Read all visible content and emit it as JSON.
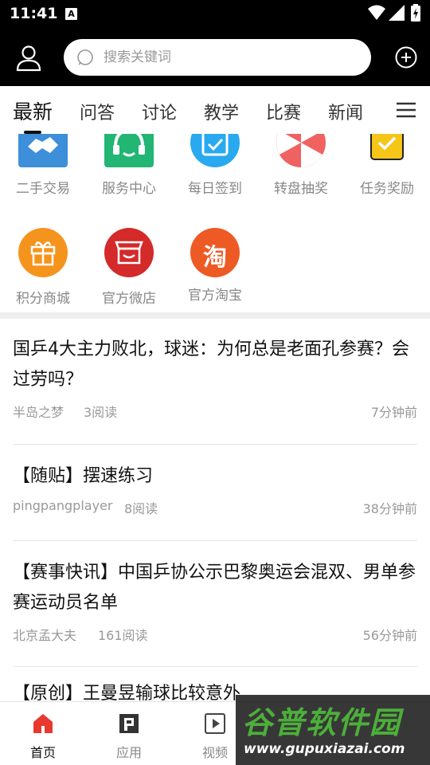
{
  "status_bar": {
    "time": "11:41",
    "a_badge": "A"
  },
  "search": {
    "placeholder": "搜索关键词"
  },
  "tabs": [
    {
      "label": "最新",
      "active": true
    },
    {
      "label": "问答"
    },
    {
      "label": "讨论"
    },
    {
      "label": "教学"
    },
    {
      "label": "比赛"
    },
    {
      "label": "新闻"
    }
  ],
  "grid": [
    {
      "label": "二手交易",
      "icon": "handshake-icon",
      "color": "#3d8fd9"
    },
    {
      "label": "服务中心",
      "icon": "headset-icon",
      "color": "#22b573"
    },
    {
      "label": "每日签到",
      "icon": "calendar-check-icon",
      "color": "#29a9ef"
    },
    {
      "label": "转盘抽奖",
      "icon": "wheel-icon",
      "color": "#f06262"
    },
    {
      "label": "任务奖励",
      "icon": "task-icon",
      "color": "#f5c518"
    },
    {
      "label": "积分商城",
      "icon": "gift-icon",
      "color": "#f5941d"
    },
    {
      "label": "官方微店",
      "icon": "shop-icon",
      "color": "#d42a2a"
    },
    {
      "label": "官方淘宝",
      "icon": "taobao-icon",
      "color": "#ee5a24",
      "glyph": "淘"
    }
  ],
  "articles": [
    {
      "title": "国乒4大主力败北，球迷：为何总是老面孔参赛？会过劳吗？",
      "author": "半岛之梦",
      "reads": "3阅读",
      "time": "7分钟前"
    },
    {
      "title": "【随贴】摆速练习",
      "author": "pingpangplayer",
      "reads": "8阅读",
      "time": "38分钟前"
    },
    {
      "title": "【赛事快讯】中国乒协公示巴黎奥运会混双、男单参赛运动员名单",
      "author": "北京孟大夫",
      "reads": "161阅读",
      "time": "56分钟前"
    },
    {
      "title": "【原创】王曼昱输球比较意外",
      "author": "",
      "reads": "",
      "time": ""
    }
  ],
  "bottom_nav": [
    {
      "label": "首页",
      "icon": "home-icon",
      "active": true
    },
    {
      "label": "应用",
      "icon": "apps-icon"
    },
    {
      "label": "视频",
      "icon": "video-icon"
    }
  ],
  "watermark": {
    "text": "谷普软件园",
    "url": "www.gupuxiazai.com"
  }
}
